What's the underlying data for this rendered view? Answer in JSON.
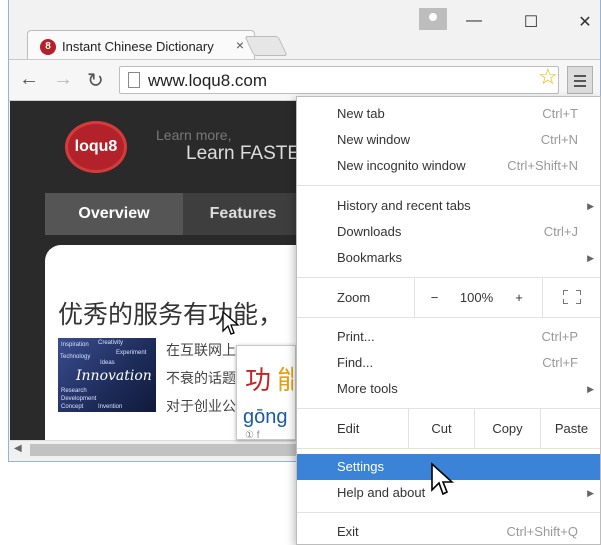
{
  "browser": {
    "tab": {
      "favicon_text": "8",
      "title": "Instant Chinese Dictionary",
      "close_label": "×"
    },
    "window_controls": {
      "minimize": "—",
      "maximize": "☐",
      "close": "✕"
    },
    "url": "www.loqu8.com"
  },
  "page": {
    "logo_text": "loqu8",
    "tagline_small": "Learn more,",
    "tagline_big": "Learn FASTE",
    "nav": {
      "overview": "Overview",
      "features": "Features"
    },
    "headline": "优秀的服务有功能，",
    "image_words": [
      "Inspiration",
      "Creativity",
      "Experiment",
      "Technology",
      "Ideas",
      "Research",
      "Development",
      "Concept",
      "Invention"
    ],
    "image_big_word": "Innovation",
    "lines": [
      "在互联网上",
      "不衰的话题",
      "对于创业公"
    ],
    "popup": {
      "char": "功",
      "char2": "能",
      "pinyin": "gōng",
      "note": "① f"
    }
  },
  "menu": {
    "new_tab": {
      "label": "New tab",
      "shortcut": "Ctrl+T"
    },
    "new_window": {
      "label": "New window",
      "shortcut": "Ctrl+N"
    },
    "new_incognito": {
      "label": "New incognito window",
      "shortcut": "Ctrl+Shift+N"
    },
    "history": {
      "label": "History and recent tabs"
    },
    "downloads": {
      "label": "Downloads",
      "shortcut": "Ctrl+J"
    },
    "bookmarks": {
      "label": "Bookmarks"
    },
    "zoom": {
      "label": "Zoom",
      "minus": "−",
      "value": "100%",
      "plus": "+"
    },
    "print": {
      "label": "Print...",
      "shortcut": "Ctrl+P"
    },
    "find": {
      "label": "Find...",
      "shortcut": "Ctrl+F"
    },
    "more_tools": {
      "label": "More tools"
    },
    "edit": {
      "label": "Edit",
      "cut": "Cut",
      "copy": "Copy",
      "paste": "Paste"
    },
    "settings": {
      "label": "Settings"
    },
    "help": {
      "label": "Help and about"
    },
    "exit": {
      "label": "Exit",
      "shortcut": "Ctrl+Shift+Q"
    },
    "submenu_arrow": "▶"
  },
  "colors": {
    "highlight": "#3b83d6",
    "brand_red": "#b3212a",
    "star": "#f3b400"
  }
}
